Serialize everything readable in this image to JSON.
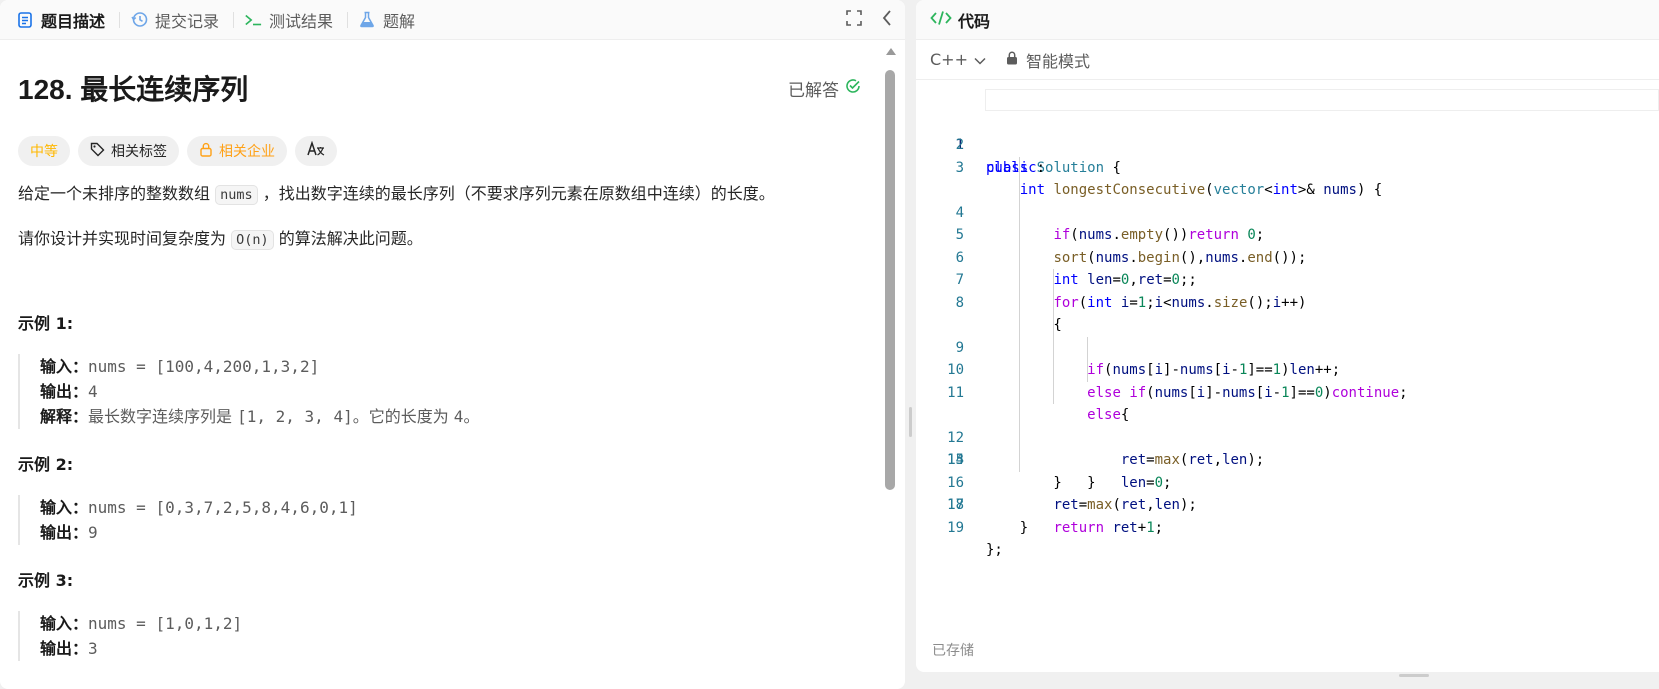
{
  "left_tabs": [
    {
      "label": "题目描述",
      "icon": "document-icon",
      "active": true
    },
    {
      "label": "提交记录",
      "icon": "history-icon",
      "active": false
    },
    {
      "label": "测试结果",
      "icon": "terminal-icon",
      "active": false
    },
    {
      "label": "题解",
      "icon": "flask-icon",
      "active": false
    }
  ],
  "problem": {
    "title": "128. 最长连续序列",
    "status": "已解答",
    "tags": {
      "difficulty": "中等",
      "topics": "相关标签",
      "companies": "相关企业",
      "translate": "A̵"
    },
    "desc1_a": "给定一个未排序的整数数组 ",
    "desc1_code": "nums",
    "desc1_b": " ，找出数字连续的最长序列（不要求序列元素在原数组中连续）的长度。",
    "desc2_a": "请你设计并实现时间复杂度为 ",
    "desc2_code": "O(n)",
    "desc2_b": " 的算法解决此问题。"
  },
  "examples": [
    {
      "title": "示例 1:",
      "input_label": "输入：",
      "input": "nums = [100,4,200,1,3,2]",
      "output_label": "输出：",
      "output": "4",
      "explain_label": "解释：",
      "explain_text": "最长数字连续序列是 ",
      "explain_code": "[1, 2, 3, 4]",
      "explain_tail": "。它的长度为 ",
      "explain_num": "4",
      "explain_end": "。"
    },
    {
      "title": "示例 2:",
      "input_label": "输入：",
      "input": "nums = [0,3,7,2,5,8,4,6,0,1]",
      "output_label": "输出：",
      "output": "9"
    },
    {
      "title": "示例 3:",
      "input_label": "输入：",
      "input": "nums = [1,0,1,2]",
      "output_label": "输出：",
      "output": "3"
    }
  ],
  "right": {
    "tab_label": "代码",
    "language": "C++",
    "mode": "智能模式",
    "saved": "已存储",
    "line_numbers": [
      "1",
      "2",
      "3",
      "4",
      "5",
      "6",
      "7",
      "8",
      "9",
      "10",
      "11",
      "12",
      "13",
      "14",
      "15",
      "16",
      "17",
      "18",
      "19"
    ]
  },
  "colors": {
    "accent_green": "#2db55d",
    "medium": "#ffb800",
    "company": "#ffa116"
  }
}
